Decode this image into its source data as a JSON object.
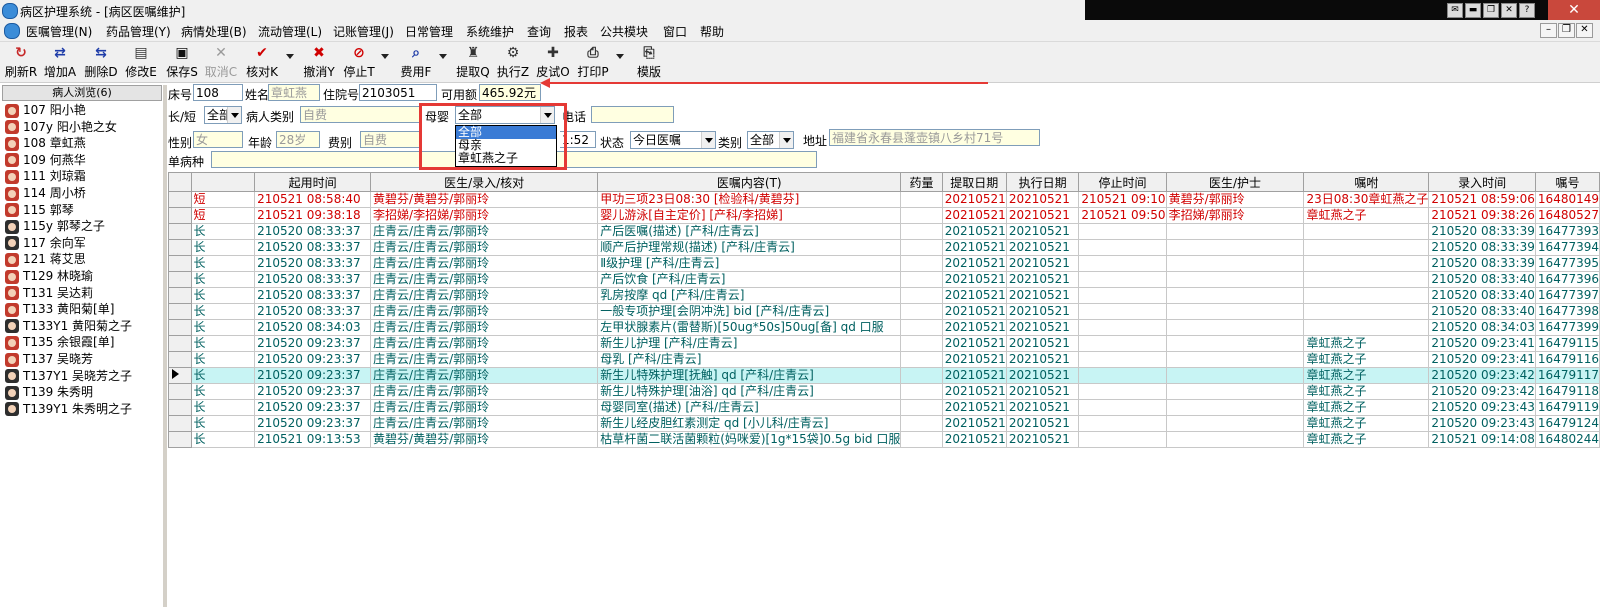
{
  "window": {
    "title": "病区护理系统 - [病区医嘱维护]"
  },
  "menu": [
    "医嘱管理(N)",
    "药品管理(Y)",
    "病情处理(B)",
    "流动管理(L)",
    "记账管理(J)",
    "日常管理",
    "系统维护",
    "查询",
    "报表",
    "公共模块",
    "窗口",
    "帮助"
  ],
  "toolbar": [
    {
      "label": "刷新R",
      "icon": "refresh-icon"
    },
    {
      "label": "增加A",
      "icon": "add-icon"
    },
    {
      "label": "删除D",
      "icon": "delete-icon"
    },
    {
      "label": "修改E",
      "icon": "edit-icon"
    },
    {
      "label": "保存S",
      "icon": "save-icon"
    },
    {
      "label": "取消C",
      "icon": "cancel-icon",
      "disabled": true
    },
    {
      "label": "核对K",
      "icon": "check-icon"
    },
    {
      "label": "撤消Y",
      "icon": "undo-icon"
    },
    {
      "label": "停止T",
      "icon": "stop-icon"
    },
    {
      "label": "费用F",
      "icon": "fee-icon"
    },
    {
      "label": "提取Q",
      "icon": "extract-icon"
    },
    {
      "label": "执行Z",
      "icon": "execute-icon"
    },
    {
      "label": "皮试O",
      "icon": "skin-test-icon"
    },
    {
      "label": "打印P",
      "icon": "print-icon"
    },
    {
      "label": "模版",
      "icon": "template-icon"
    }
  ],
  "patients": {
    "header": "病人浏览(6)",
    "items": [
      {
        "label": "107  阳小艳",
        "gender": "f"
      },
      {
        "label": "107y  阳小艳之女",
        "gender": "f"
      },
      {
        "label": "108  章虹燕",
        "gender": "f"
      },
      {
        "label": "109  何燕华",
        "gender": "f"
      },
      {
        "label": "111  刘琼霜",
        "gender": "f"
      },
      {
        "label": "114  周小桥",
        "gender": "f"
      },
      {
        "label": "115  郭琴",
        "gender": "f"
      },
      {
        "label": "115y  郭琴之子",
        "gender": "m"
      },
      {
        "label": "117  余向军",
        "gender": "m"
      },
      {
        "label": "121  蒋艾思",
        "gender": "f"
      },
      {
        "label": "T129  林晓瑜",
        "gender": "f"
      },
      {
        "label": "T131  吴达莉",
        "gender": "f"
      },
      {
        "label": "T133  黄阳菊[单]",
        "gender": "f"
      },
      {
        "label": "T133Y1  黄阳菊之子",
        "gender": "m"
      },
      {
        "label": "T135  余银霞[单]",
        "gender": "f"
      },
      {
        "label": "T137  吴晓芳",
        "gender": "f"
      },
      {
        "label": "T137Y1  吴晓芳之子",
        "gender": "m"
      },
      {
        "label": "T139  朱秀明",
        "gender": "m"
      },
      {
        "label": "T139Y1  朱秀明之子",
        "gender": "m"
      }
    ]
  },
  "form": {
    "bed_label": "床号",
    "bed": "108",
    "name_label": "姓名",
    "name": "章虹燕",
    "admission_label": "住院号",
    "admission": "2103051",
    "balance_label": "可用额",
    "balance": "465.92元",
    "term_label": "长/短",
    "term": "全部",
    "ptype_label": "病人类别",
    "ptype": "自费",
    "mother_label": "母婴",
    "mother": "全部",
    "phone_label": "电话",
    "phone": "",
    "gender_label": "性别",
    "gender": "女",
    "age_label": "年龄",
    "age": "28岁",
    "feetype_label": "费别",
    "feetype": "自费",
    "time_fragment": "1:52",
    "status_label": "状态",
    "status": "今日医嘱",
    "category_label": "类别",
    "category": "全部",
    "address_label": "地址",
    "address": "福建省永春县蓬壶镇八乡村71号",
    "disease_label": "单病种",
    "disease": ""
  },
  "dropdown": {
    "options": [
      "全部",
      "母亲",
      "章虹燕之子"
    ],
    "selected": 0
  },
  "grid": {
    "columns": [
      "起用时间",
      "医生/录入/核对",
      "医嘱内容(T)",
      "药量",
      "提取日期",
      "执行日期",
      "停止时间",
      "医生/护士",
      "嘱咐",
      "录入时间",
      "嘱号"
    ],
    "rows": [
      {
        "type": "短",
        "start": "210521 08:58:40",
        "doctor": "黄碧芬/黄碧芬/郭丽玲",
        "content": "甲功三项23日08:30  [检验科/黄碧芬]",
        "dose": "",
        "extract": "20210521",
        "exec": "20210521",
        "stop": "210521 09:10",
        "nurse": "黄碧芬/郭丽玲",
        "note": "23日08:30章虹燕之子",
        "entered": "210521 08:59:06",
        "no": "16480149",
        "color": "red"
      },
      {
        "type": "短",
        "start": "210521 09:38:18",
        "doctor": "李招娣/李招娣/郭丽玲",
        "content": "婴儿游泳[自主定价]  [产科/李招娣]",
        "dose": "",
        "extract": "20210521",
        "exec": "20210521",
        "stop": "210521 09:50",
        "nurse": "李招娣/郭丽玲",
        "note": "章虹燕之子",
        "entered": "210521 09:38:26",
        "no": "16480527",
        "color": "red"
      },
      {
        "type": "长",
        "start": "210520 08:33:37",
        "doctor": "庄青云/庄青云/郭丽玲",
        "content": "产后医嘱(描述)  [产科/庄青云]",
        "dose": "",
        "extract": "20210521",
        "exec": "20210521",
        "stop": "",
        "nurse": "",
        "note": "",
        "entered": "210520 08:33:39",
        "no": "16477393",
        "color": "teal"
      },
      {
        "type": "长",
        "start": "210520 08:33:37",
        "doctor": "庄青云/庄青云/郭丽玲",
        "content": "顺产后护理常规(描述)  [产科/庄青云]",
        "dose": "",
        "extract": "20210521",
        "exec": "20210521",
        "stop": "",
        "nurse": "",
        "note": "",
        "entered": "210520 08:33:39",
        "no": "16477394",
        "color": "teal"
      },
      {
        "type": "长",
        "start": "210520 08:33:37",
        "doctor": "庄青云/庄青云/郭丽玲",
        "content": "Ⅱ级护理  [产科/庄青云]",
        "dose": "",
        "extract": "20210521",
        "exec": "20210521",
        "stop": "",
        "nurse": "",
        "note": "",
        "entered": "210520 08:33:39",
        "no": "16477395",
        "color": "teal"
      },
      {
        "type": "长",
        "start": "210520 08:33:37",
        "doctor": "庄青云/庄青云/郭丽玲",
        "content": "产后饮食  [产科/庄青云]",
        "dose": "",
        "extract": "20210521",
        "exec": "20210521",
        "stop": "",
        "nurse": "",
        "note": "",
        "entered": "210520 08:33:40",
        "no": "16477396",
        "color": "teal"
      },
      {
        "type": "长",
        "start": "210520 08:33:37",
        "doctor": "庄青云/庄青云/郭丽玲",
        "content": "乳房按摩 qd  [产科/庄青云]",
        "dose": "",
        "extract": "20210521",
        "exec": "20210521",
        "stop": "",
        "nurse": "",
        "note": "",
        "entered": "210520 08:33:40",
        "no": "16477397",
        "color": "teal"
      },
      {
        "type": "长",
        "start": "210520 08:33:37",
        "doctor": "庄青云/庄青云/郭丽玲",
        "content": "一般专项护理[会阴冲洗] bid  [产科/庄青云]",
        "dose": "",
        "extract": "20210521",
        "exec": "20210521",
        "stop": "",
        "nurse": "",
        "note": "",
        "entered": "210520 08:33:40",
        "no": "16477398",
        "color": "teal"
      },
      {
        "type": "长",
        "start": "210520 08:34:03",
        "doctor": "庄青云/庄青云/郭丽玲",
        "content": "左甲状腺素片(雷替斯)[50ug*50s]50ug[备] qd 口服",
        "dose": "",
        "extract": "20210521",
        "exec": "20210521",
        "stop": "",
        "nurse": "",
        "note": "",
        "entered": "210520 08:34:03",
        "no": "16477399",
        "color": "teal"
      },
      {
        "type": "长",
        "start": "210520 09:23:37",
        "doctor": "庄青云/庄青云/郭丽玲",
        "content": "新生儿护理  [产科/庄青云]",
        "dose": "",
        "extract": "20210521",
        "exec": "20210521",
        "stop": "",
        "nurse": "",
        "note": "章虹燕之子",
        "entered": "210520 09:23:41",
        "no": "16479115",
        "color": "teal"
      },
      {
        "type": "长",
        "start": "210520 09:23:37",
        "doctor": "庄青云/庄青云/郭丽玲",
        "content": "母乳  [产科/庄青云]",
        "dose": "",
        "extract": "20210521",
        "exec": "20210521",
        "stop": "",
        "nurse": "",
        "note": "章虹燕之子",
        "entered": "210520 09:23:41",
        "no": "16479116",
        "color": "teal"
      },
      {
        "type": "长",
        "start": "210520 09:23:37",
        "doctor": "庄青云/庄青云/郭丽玲",
        "content": "新生儿特殊护理[抚触] qd  [产科/庄青云]",
        "dose": "",
        "extract": "20210521",
        "exec": "20210521",
        "stop": "",
        "nurse": "",
        "note": "章虹燕之子",
        "entered": "210520 09:23:42",
        "no": "16479117",
        "color": "teal",
        "current": true
      },
      {
        "type": "长",
        "start": "210520 09:23:37",
        "doctor": "庄青云/庄青云/郭丽玲",
        "content": "新生儿特殊护理[油浴] qd  [产科/庄青云]",
        "dose": "",
        "extract": "20210521",
        "exec": "20210521",
        "stop": "",
        "nurse": "",
        "note": "章虹燕之子",
        "entered": "210520 09:23:42",
        "no": "16479118",
        "color": "teal"
      },
      {
        "type": "长",
        "start": "210520 09:23:37",
        "doctor": "庄青云/庄青云/郭丽玲",
        "content": "母婴同室(描述)  [产科/庄青云]",
        "dose": "",
        "extract": "20210521",
        "exec": "20210521",
        "stop": "",
        "nurse": "",
        "note": "章虹燕之子",
        "entered": "210520 09:23:43",
        "no": "16479119",
        "color": "teal"
      },
      {
        "type": "长",
        "start": "210520 09:23:37",
        "doctor": "庄青云/庄青云/郭丽玲",
        "content": "新生儿经皮胆红素测定 qd  [小儿科/庄青云]",
        "dose": "",
        "extract": "20210521",
        "exec": "20210521",
        "stop": "",
        "nurse": "",
        "note": "章虹燕之子",
        "entered": "210520 09:23:43",
        "no": "16479124",
        "color": "teal"
      },
      {
        "type": "长",
        "start": "210521 09:13:53",
        "doctor": "黄碧芬/黄碧芬/郭丽玲",
        "content": "枯草杆菌二联活菌颗粒(妈咪爱)[1g*15袋]0.5g bid 口服",
        "dose": "",
        "extract": "20210521",
        "exec": "20210521",
        "stop": "",
        "nurse": "",
        "note": "章虹燕之子",
        "entered": "210521 09:14:08",
        "no": "16480244",
        "color": "teal",
        "tall": true
      }
    ]
  },
  "colors": {
    "short_order": "#d00000",
    "long_order": "#006060",
    "highlight_row": "#c8f4f4",
    "annotation": "#e53935"
  }
}
